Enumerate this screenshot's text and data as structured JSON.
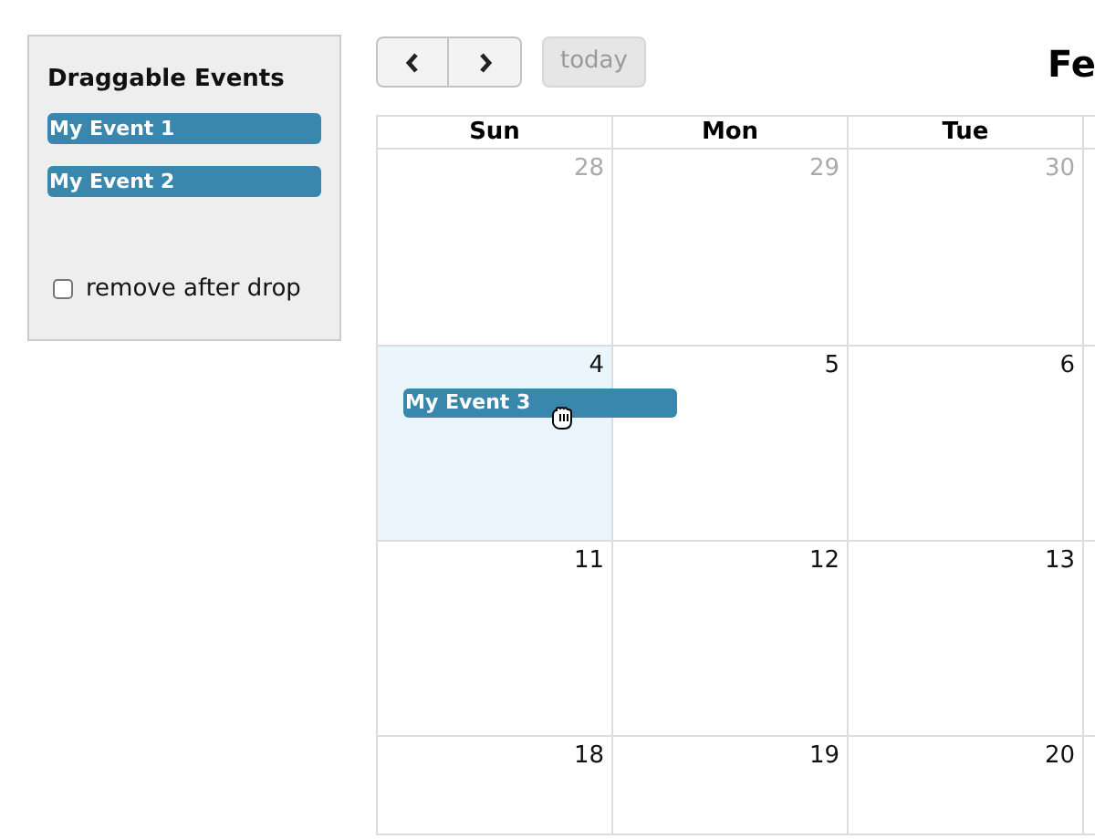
{
  "sidebar": {
    "title": "Draggable Events",
    "events": [
      {
        "label": "My Event 1"
      },
      {
        "label": "My Event 2"
      }
    ],
    "remove_after_drop": {
      "label": "remove after drop",
      "checked": false
    }
  },
  "toolbar": {
    "today": {
      "label": "today",
      "disabled": true
    }
  },
  "title": "Fe",
  "day_headers": [
    "Sun",
    "Mon",
    "Tue"
  ],
  "weeks": [
    [
      {
        "day": "28",
        "other_month": true,
        "highlighted": false
      },
      {
        "day": "29",
        "other_month": true,
        "highlighted": false
      },
      {
        "day": "30",
        "other_month": true,
        "highlighted": false
      }
    ],
    [
      {
        "day": "4",
        "other_month": false,
        "highlighted": true,
        "events": [
          {
            "label": "My Event 3",
            "dragging": true
          }
        ]
      },
      {
        "day": "5",
        "other_month": false,
        "highlighted": false
      },
      {
        "day": "6",
        "other_month": false,
        "highlighted": false
      }
    ],
    [
      {
        "day": "11",
        "other_month": false,
        "highlighted": false
      },
      {
        "day": "12",
        "other_month": false,
        "highlighted": false
      },
      {
        "day": "13",
        "other_month": false,
        "highlighted": false
      }
    ],
    [
      {
        "day": "18",
        "other_month": false,
        "highlighted": false
      },
      {
        "day": "19",
        "other_month": false,
        "highlighted": false
      },
      {
        "day": "20",
        "other_month": false,
        "highlighted": false
      }
    ]
  ]
}
